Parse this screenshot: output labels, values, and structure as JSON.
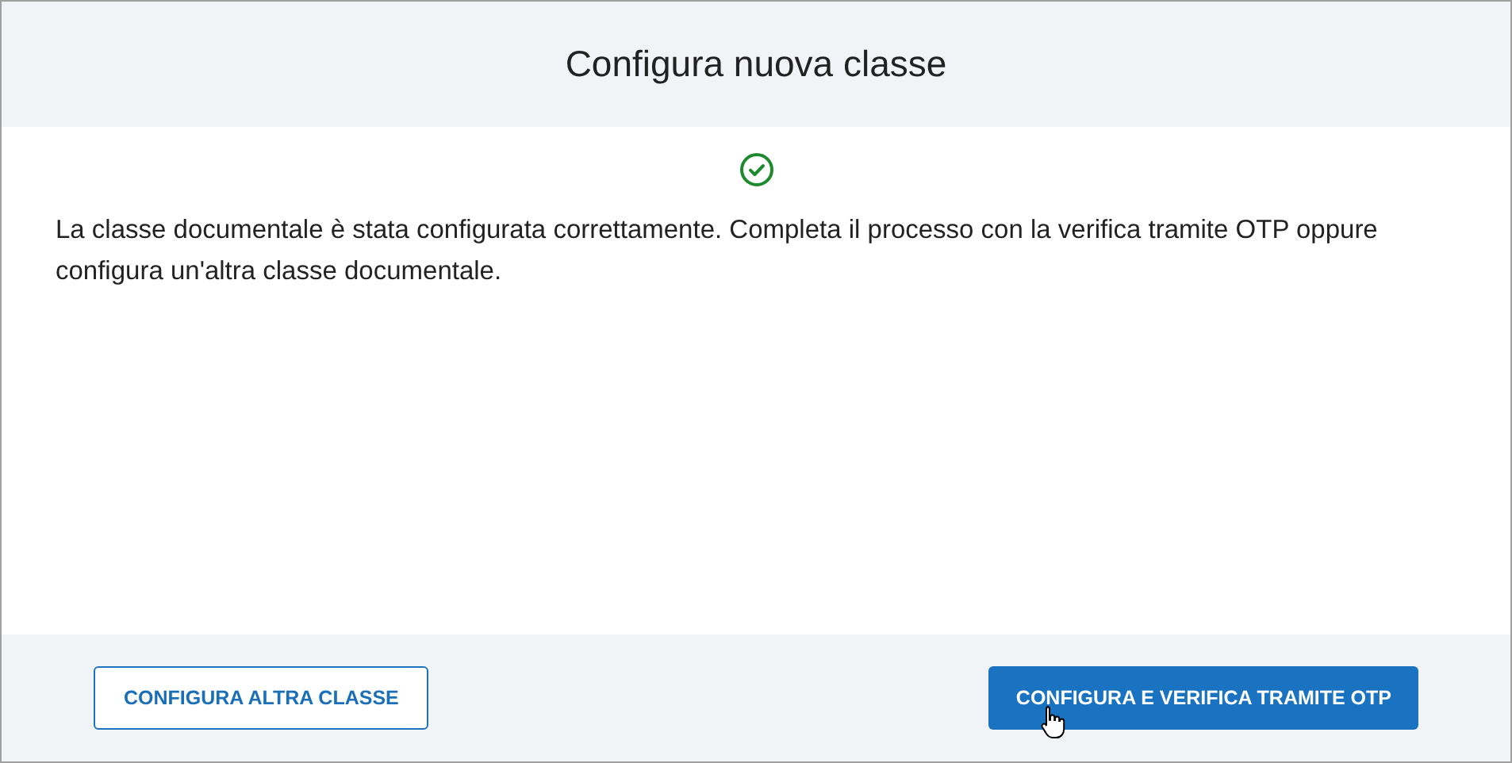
{
  "dialog": {
    "title": "Configura nuova classe",
    "success": true,
    "message": "La classe documentale è stata configurata correttamente. Completa il processo con la verifica tramite OTP oppure configura un'altra classe documentale.",
    "buttons": [
      {
        "label": "CONFIGURA ALTRA CLASSE",
        "kind": "secondary"
      },
      {
        "label": "CONFIGURA E VERIFICA TRAMITE OTP",
        "kind": "primary"
      }
    ]
  }
}
